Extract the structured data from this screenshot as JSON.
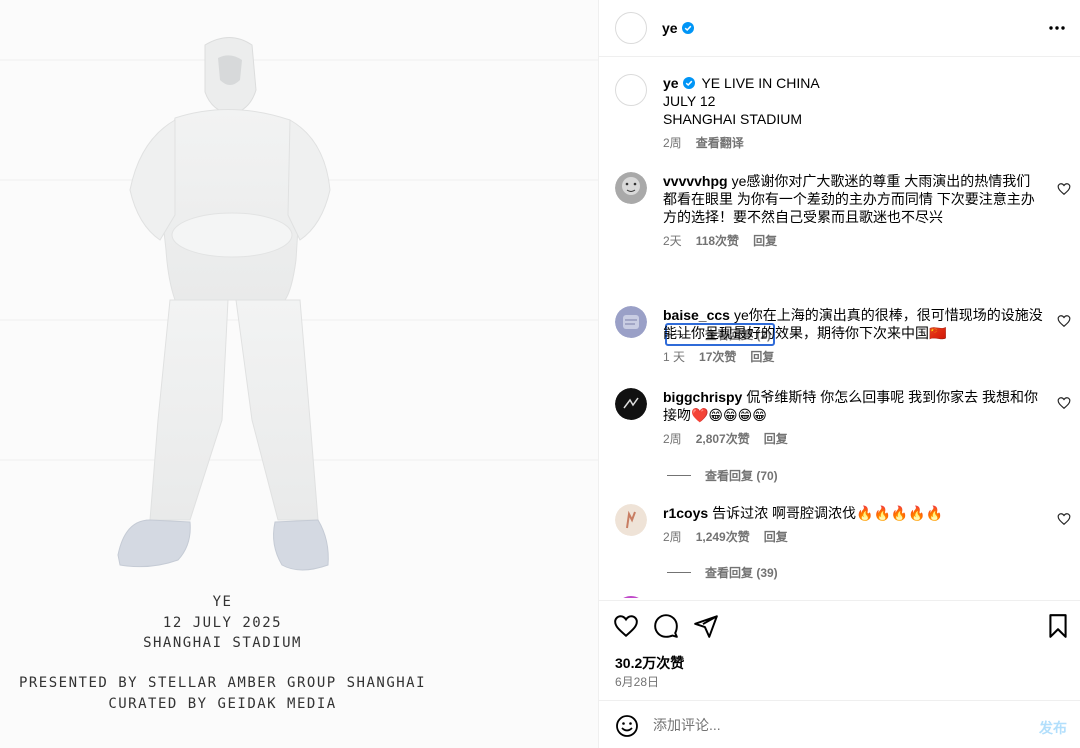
{
  "poster": {
    "lines_top": [
      "YE",
      "12 JULY 2025",
      "SHANGHAI STADIUM"
    ],
    "lines_bottom": [
      "PRESENTED BY STELLAR AMBER GROUP SHANGHAI",
      "CURATED BY GEIDAK MEDIA"
    ]
  },
  "header": {
    "username": "ye"
  },
  "caption": {
    "username": "ye",
    "line1": "YE LIVE IN CHINA",
    "line2": "JULY 12",
    "line3": "SHANGHAI STADIUM",
    "age": "2周",
    "translate": "查看翻译"
  },
  "comments": [
    {
      "username": "vvvvvhpg",
      "text": "ye感谢你对广大歌迷的尊重 大雨演出的热情我们都看在眼里 为你有一个差劲的主办方而同情 下次要注意主办方的选择！要不然自己受累而且歌迷也不尽兴",
      "age": "2天",
      "likes": "118次赞",
      "reply": "回复",
      "view_replies": "查看回复 (2)"
    },
    {
      "username": "baise_ccs",
      "text": "ye你在上海的演出真的很棒，很可惜现场的设施没能让你呈现最好的效果，期待你下次来中国🇨🇳",
      "age": "1 天",
      "likes": "17次赞",
      "reply": "回复"
    },
    {
      "username": "biggchrispy",
      "text": "侃爷维斯特 你怎么回事呢 我到你家去 我想和你接吻❤️😁😁😁😁",
      "age": "2周",
      "likes": "2,807次赞",
      "reply": "回复",
      "view_replies": "查看回复 (70)"
    },
    {
      "username": "r1coys",
      "text": "告诉过浓 啊哥腔调浓伐🔥🔥🔥🔥🔥",
      "age": "2周",
      "likes": "1,249次赞",
      "reply": "回复",
      "view_replies": "查看回复 (39)"
    }
  ],
  "footer": {
    "likes": "30.2万次赞",
    "date": "6月28日",
    "comment_placeholder": "添加评论...",
    "post_label": "发布"
  },
  "colors": {
    "verified": "#0095f6",
    "link_blue": "#b2dffc",
    "focus": "#2f6bd8"
  }
}
